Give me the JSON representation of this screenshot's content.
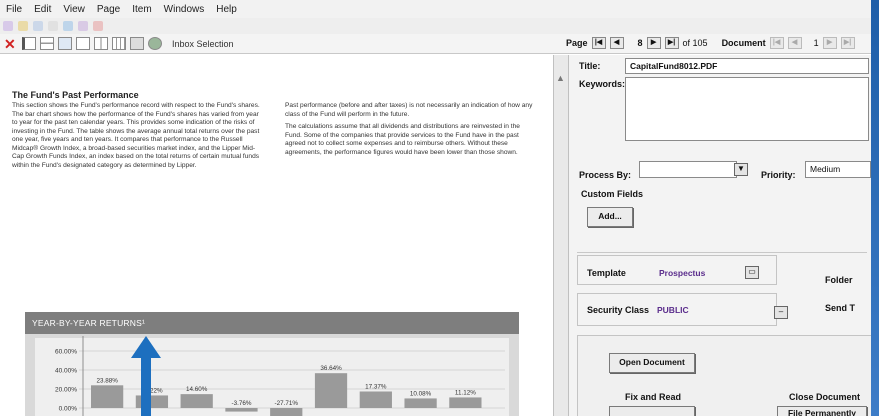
{
  "menu": [
    "File",
    "Edit",
    "View",
    "Page",
    "Item",
    "Windows",
    "Help"
  ],
  "toolbar": {
    "inbox_label": "Inbox Selection"
  },
  "page_nav": {
    "page_label": "Page",
    "current_page": "8",
    "total_pages": "of 105",
    "document_label": "Document",
    "document_index": "1"
  },
  "document": {
    "heading": "The Fund's Past Performance",
    "left_column": [
      "This section shows the Fund's performance record with respect to the Fund's shares. The bar chart shows how the performance of the Fund's shares has varied from year to year for the past ten calendar years. This provides some indication of the risks of investing in the Fund. The table shows the average annual total returns over the past one year, five years and ten years. It compares that performance to the Russell Midcap® Growth Index, a broad-based securities market index, and the Lipper Mid-Cap Growth Funds Index, an index based on the total returns of certain mutual funds within the Fund's designated category as determined by Lipper."
    ],
    "right_column": [
      "Past performance (before and after taxes) is not necessarily an indication of how any class of the Fund will perform in the future.",
      "The calculations assume that all dividends and distributions are reinvested in the Fund. Some of the companies that provide services to the Fund have in the past agreed not to collect some expenses and to reimburse others. Without these agreements, the performance figures would have been lower than those shown."
    ],
    "chart_title": "YEAR-BY-YEAR RETURNS¹"
  },
  "chart_data": {
    "type": "bar",
    "title": "YEAR-BY-YEAR RETURNS¹",
    "ytick_labels": [
      "60.00%",
      "40.00%",
      "20.00%",
      "0.00%"
    ],
    "ylim": [
      -20,
      60
    ],
    "values": [
      23.88,
      13.22,
      14.6,
      -3.76,
      -27.71,
      36.64,
      17.37,
      10.08,
      11.12
    ],
    "value_labels": [
      "23.88%",
      "13.22%",
      "14.60%",
      "-3.76%",
      "-27.71%",
      "36.64%",
      "17.37%",
      "10.08%",
      "11.12%"
    ],
    "grid": true,
    "colors": {
      "bar": "#9a9a9a",
      "header": "#7e7e7e"
    }
  },
  "form": {
    "title_label": "Title:",
    "title_value": "CapitalFund8012.PDF",
    "keywords_label": "Keywords:",
    "keywords_value": "",
    "process_by_label": "Process By:",
    "process_by_value": "",
    "priority_label": "Priority:",
    "priority_value": "Medium",
    "custom_fields_label": "Custom Fields",
    "add_button": "Add...",
    "template_label": "Template",
    "template_value": "Prospectus",
    "folder_button": "Folder",
    "security_label": "Security Class",
    "security_value": "PUBLIC",
    "send_button": "Send T",
    "open_button": "Open Document",
    "fix_read_label": "Fix and Read",
    "close_doc_label": "Close Document",
    "file_perm_button": "File Permanently"
  },
  "colors": {
    "accent_blue": "#2b6cb3",
    "purple_value": "#5a2c8c",
    "close_red": "#d12222"
  }
}
